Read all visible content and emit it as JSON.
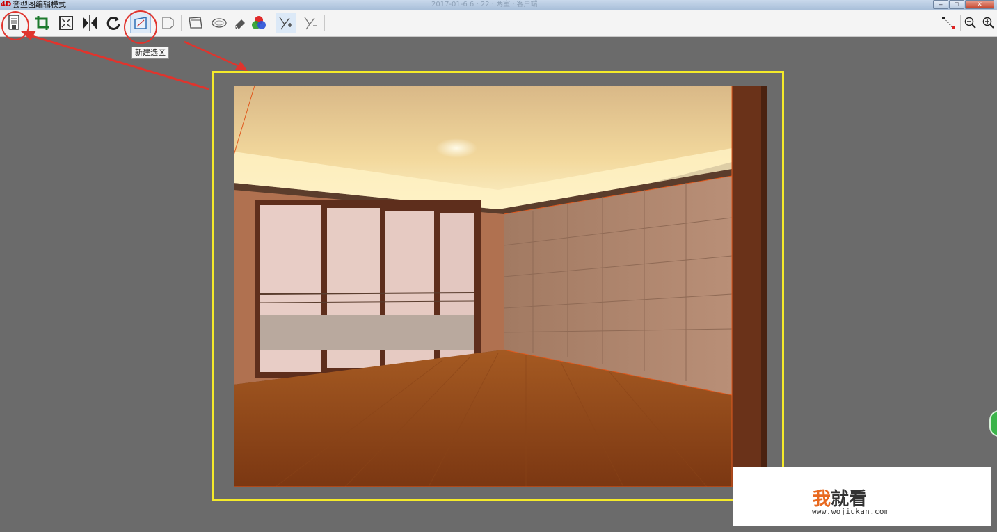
{
  "window": {
    "title": "套型图编辑模式",
    "center_title": "2017-01-6 6 · 22 · 两室 · 客户端",
    "minimize_glyph": "–",
    "maximize_glyph": "□",
    "close_glyph": "✕"
  },
  "toolbar": {
    "tools": [
      {
        "name": "save-tool-icon"
      },
      {
        "name": "crop-icon"
      },
      {
        "name": "fit-screen-icon"
      },
      {
        "name": "flip-icon"
      },
      {
        "name": "rotate-icon"
      },
      {
        "name": "new-selection-icon"
      },
      {
        "name": "perspective-icon"
      },
      {
        "name": "polygon-select-icon"
      },
      {
        "name": "ellipse-select-icon"
      },
      {
        "name": "eraser-icon"
      },
      {
        "name": "color-adjust-icon"
      },
      {
        "name": "magic-select-add-icon"
      },
      {
        "name": "magic-select-remove-icon"
      },
      {
        "name": "measure-icon"
      },
      {
        "name": "zoom-out-icon"
      },
      {
        "name": "zoom-in-icon"
      }
    ],
    "tooltip": "新建选区"
  },
  "watermark": {
    "brand_first": "我",
    "brand_rest": "就看",
    "url": "www.wojiukan.com"
  },
  "colors": {
    "canvas_bg": "#6b6b6b",
    "selection_frame": "#f4ea2a",
    "annotation_red": "#e0342d"
  }
}
